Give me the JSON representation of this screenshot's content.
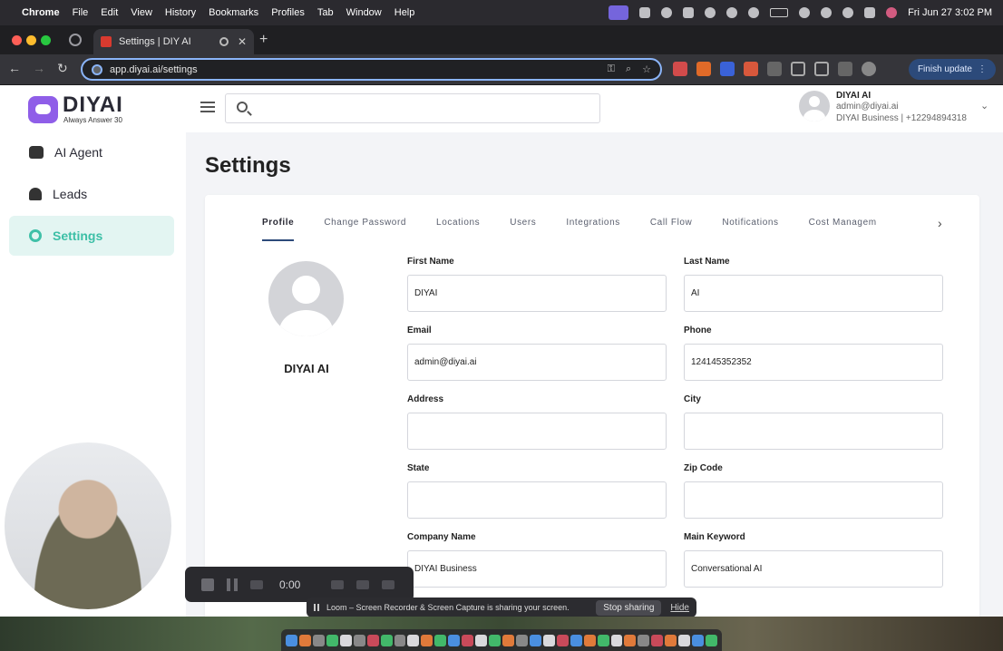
{
  "menubar": {
    "app_name": "Chrome",
    "items": [
      "File",
      "Edit",
      "View",
      "History",
      "Bookmarks",
      "Profiles",
      "Tab",
      "Window",
      "Help"
    ],
    "clock": "Fri Jun 27  3:02 PM"
  },
  "browser": {
    "tab_title": "Settings | DIY AI",
    "url": "app.diyai.ai/settings",
    "finish_update_label": "Finish update"
  },
  "app": {
    "logo": {
      "title": "DIYAI",
      "tagline": "Always Answer 30"
    },
    "sidebar": {
      "items": [
        {
          "label": "AI Agent",
          "icon": "robot-icon",
          "active": false
        },
        {
          "label": "Leads",
          "icon": "user-plus-icon",
          "active": false
        },
        {
          "label": "Settings",
          "icon": "gear-icon",
          "active": true
        }
      ]
    },
    "search": {
      "value": ""
    },
    "user": {
      "name": "DIYAI AI",
      "email": "admin@diyai.ai",
      "business_line": "DIYAI Business | +12294894318"
    },
    "page_title": "Settings",
    "tabs": [
      "Profile",
      "Change Password",
      "Locations",
      "Users",
      "Integrations",
      "Call Flow",
      "Notifications",
      "Cost Managem"
    ],
    "profile": {
      "display_name": "DIYAI AI",
      "fields": {
        "first_name": {
          "label": "First Name",
          "value": "DIYAI"
        },
        "last_name": {
          "label": "Last Name",
          "value": "AI"
        },
        "email": {
          "label": "Email",
          "value": "admin@diyai.ai"
        },
        "phone": {
          "label": "Phone",
          "value": "124145352352"
        },
        "address": {
          "label": "Address",
          "value": ""
        },
        "city": {
          "label": "City",
          "value": ""
        },
        "state": {
          "label": "State",
          "value": ""
        },
        "zip": {
          "label": "Zip Code",
          "value": ""
        },
        "company": {
          "label": "Company Name",
          "value": "DIYAI Business"
        },
        "keyword": {
          "label": "Main Keyword",
          "value": "Conversational AI"
        }
      }
    }
  },
  "loom": {
    "timer": "0:00",
    "share_text": "Loom – Screen Recorder & Screen Capture is sharing your screen.",
    "stop_sharing_label": "Stop sharing",
    "hide_label": "Hide"
  }
}
